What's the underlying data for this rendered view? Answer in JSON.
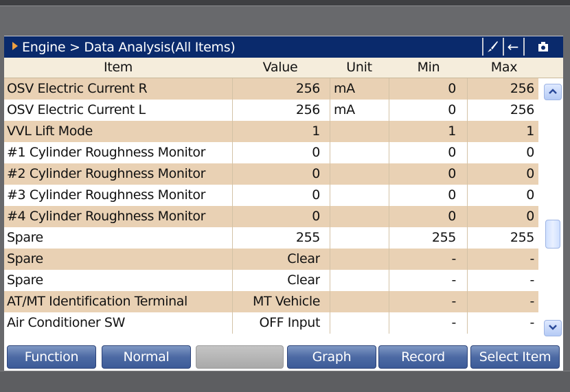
{
  "breadcrumb": "Engine > Data Analysis(All Items)",
  "title_buttons": [
    {
      "icon": "brush-icon"
    },
    {
      "icon": "back-arrow-icon",
      "glyph": "←"
    },
    {
      "icon": "camera-icon"
    }
  ],
  "columns": {
    "item": "Item",
    "value": "Value",
    "unit": "Unit",
    "min": "Min",
    "max": "Max"
  },
  "rows": [
    {
      "item": "OSV Electric Current R",
      "value": "256",
      "unit": "mA",
      "min": "0",
      "max": "256"
    },
    {
      "item": "OSV Electric Current L",
      "value": "256",
      "unit": "mA",
      "min": "0",
      "max": "256"
    },
    {
      "item": "VVL Lift Mode",
      "value": "1",
      "unit": "",
      "min": "1",
      "max": "1"
    },
    {
      "item": "#1 Cylinder Roughness Monitor",
      "value": "0",
      "unit": "",
      "min": "0",
      "max": "0"
    },
    {
      "item": "#2 Cylinder Roughness Monitor",
      "value": "0",
      "unit": "",
      "min": "0",
      "max": "0"
    },
    {
      "item": "#3 Cylinder Roughness Monitor",
      "value": "0",
      "unit": "",
      "min": "0",
      "max": "0"
    },
    {
      "item": "#4 Cylinder Roughness Monitor",
      "value": "0",
      "unit": "",
      "min": "0",
      "max": "0"
    },
    {
      "item": "Spare",
      "value": "255",
      "unit": "",
      "min": "255",
      "max": "255"
    },
    {
      "item": "Spare",
      "value": "Clear",
      "unit": "",
      "min": "-",
      "max": "-"
    },
    {
      "item": "Spare",
      "value": "Clear",
      "unit": "",
      "min": "-",
      "max": "-"
    },
    {
      "item": "AT/MT Identification Terminal",
      "value": "MT Vehicle",
      "unit": "",
      "min": "-",
      "max": "-"
    },
    {
      "item": "Air Conditioner SW",
      "value": "OFF Input",
      "unit": "",
      "min": "-",
      "max": "-"
    }
  ],
  "function_buttons": [
    {
      "label": "Function",
      "enabled": true
    },
    {
      "label": "Normal",
      "enabled": true
    },
    {
      "label": "",
      "enabled": false
    },
    {
      "label": "Graph",
      "enabled": true
    },
    {
      "label": "Record",
      "enabled": true
    },
    {
      "label": "Select Item",
      "enabled": true
    }
  ],
  "colors": {
    "titlebar": "#0a2a6c",
    "row_alt": "#e9d1b4",
    "row_plain": "#ffffff",
    "button": "#4d6aa4",
    "accent_arrow": "#f0a040"
  },
  "scrollbar": {
    "position_fraction": 0.62
  }
}
